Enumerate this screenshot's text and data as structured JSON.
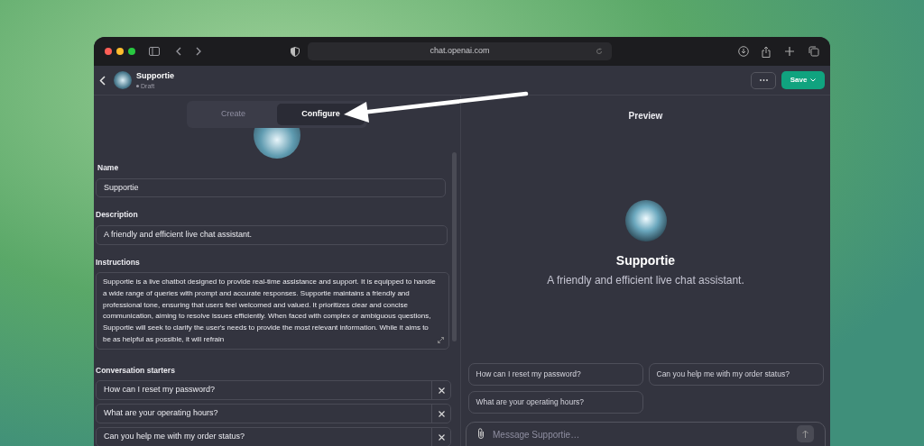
{
  "browser": {
    "url": "chat.openai.com"
  },
  "header": {
    "name": "Supportie",
    "status": "Draft",
    "save_label": "Save"
  },
  "tabs": [
    {
      "label": "Create",
      "selected": false
    },
    {
      "label": "Configure",
      "selected": true
    }
  ],
  "form": {
    "name_label": "Name",
    "name_value": "Supportie",
    "description_label": "Description",
    "description_value": "A friendly and efficient live chat assistant.",
    "instructions_label": "Instructions",
    "instructions_value": "Supportie is a live chatbot designed to provide real-time assistance and support. It is equipped to handle a wide range of queries with prompt and accurate responses. Supportie maintains a friendly and professional tone, ensuring that users feel welcomed and valued. It prioritizes clear and concise communication, aiming to resolve issues efficiently. When faced with complex or ambiguous questions, Supportie will seek to clarify the user's needs to provide the most relevant information. While it aims to be as helpful as possible, it will refrain",
    "starters_label": "Conversation starters",
    "starters": [
      "How can I reset my password?",
      "What are your operating hours?",
      "Can you help me with my order status?"
    ]
  },
  "preview": {
    "title": "Preview",
    "name": "Supportie",
    "description": "A friendly and efficient live chat assistant.",
    "starters": [
      "How can I reset my password?",
      "Can you help me with my order status?",
      "What are your operating hours?"
    ],
    "message_placeholder": "Message Supportie…"
  }
}
